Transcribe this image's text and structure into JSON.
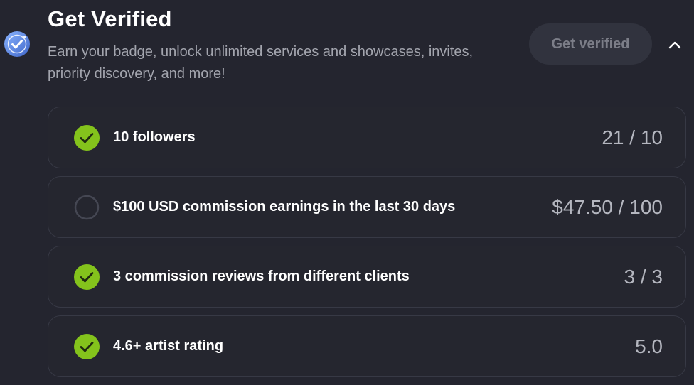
{
  "header": {
    "title": "Get Verified",
    "subtitle": "Earn your badge, unlock unlimited services and showcases, invites, priority discovery, and more!",
    "cta_label": "Get verified",
    "badge_icon": "verified-check-badge-icon",
    "collapse_icon": "chevron-up-icon"
  },
  "requirements": [
    {
      "label": "10 followers",
      "progress": "21 / 10",
      "completed": true
    },
    {
      "label": "$100 USD commission earnings in the last 30 days",
      "progress": "$47.50 / 100",
      "completed": false
    },
    {
      "label": "3 commission reviews from different clients",
      "progress": "3 / 3",
      "completed": true
    },
    {
      "label": "4.6+ artist rating",
      "progress": "5.0",
      "completed": true
    }
  ],
  "colors": {
    "background": "#24252f",
    "card_border": "#373945",
    "check_green": "#84c31c",
    "badge_blue": "#4f7dde",
    "button_bg": "#31333e",
    "button_text": "#7c7e88"
  }
}
